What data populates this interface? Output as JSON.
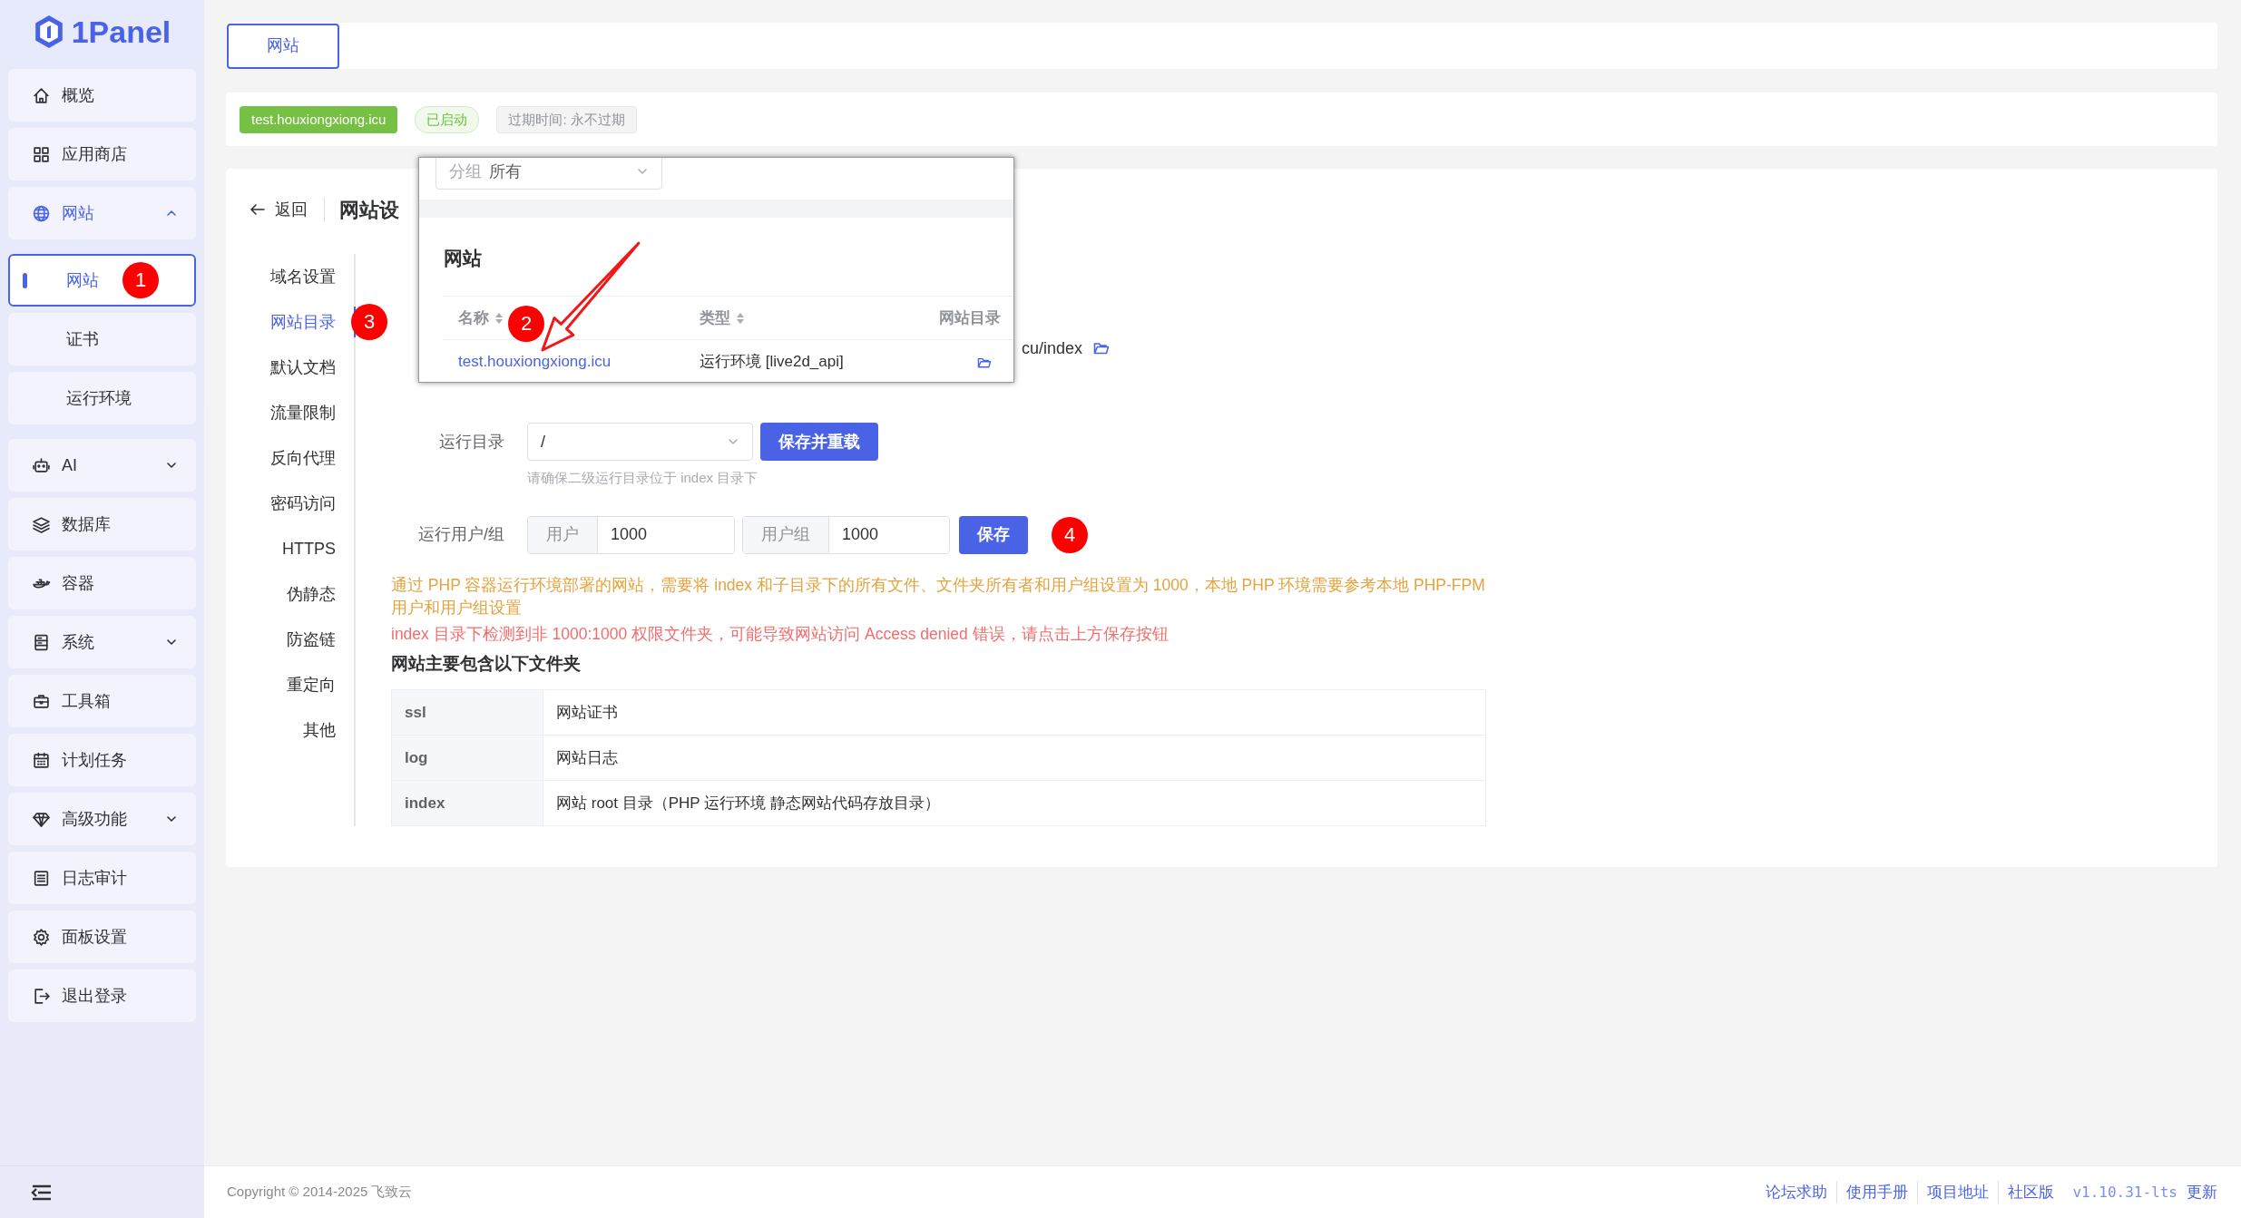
{
  "logo": {
    "text": "1Panel"
  },
  "sidebar": {
    "items": [
      {
        "label": "概览",
        "kind": "link",
        "selected": false
      },
      {
        "label": "应用商店",
        "kind": "link",
        "selected": false
      },
      {
        "label": "网站",
        "kind": "group",
        "selected": true,
        "expanded": true,
        "children": [
          {
            "label": "网站",
            "selected": true,
            "badge": "1"
          },
          {
            "label": "证书",
            "selected": false
          },
          {
            "label": "运行环境",
            "selected": false
          }
        ]
      },
      {
        "label": "AI",
        "kind": "group",
        "selected": false,
        "expanded": false
      },
      {
        "label": "数据库",
        "kind": "link",
        "selected": false
      },
      {
        "label": "容器",
        "kind": "link",
        "selected": false
      },
      {
        "label": "系统",
        "kind": "group",
        "selected": false,
        "expanded": false
      },
      {
        "label": "工具箱",
        "kind": "link",
        "selected": false
      },
      {
        "label": "计划任务",
        "kind": "link",
        "selected": false
      },
      {
        "label": "高级功能",
        "kind": "group",
        "selected": false,
        "expanded": false
      },
      {
        "label": "日志审计",
        "kind": "link",
        "selected": false
      },
      {
        "label": "面板设置",
        "kind": "link",
        "selected": false
      },
      {
        "label": "退出登录",
        "kind": "link",
        "selected": false
      }
    ]
  },
  "tabs": [
    {
      "label": "网站",
      "selected": true
    }
  ],
  "site_bar": {
    "tags": [
      {
        "text": "test.houxiongxiong.icu",
        "kind": "domain"
      },
      {
        "text": "已启动",
        "kind": "status"
      },
      {
        "text": "过期时间: 永不过期",
        "kind": "info"
      }
    ]
  },
  "settings": {
    "back": "返回",
    "title": "网站设",
    "menu": [
      {
        "label": "域名设置",
        "selected": false
      },
      {
        "label": "网站目录",
        "selected": true,
        "badge": "3"
      },
      {
        "label": "默认文档",
        "selected": false
      },
      {
        "label": "流量限制",
        "selected": false
      },
      {
        "label": "反向代理",
        "selected": false
      },
      {
        "label": "密码访问",
        "selected": false
      },
      {
        "label": "HTTPS",
        "selected": false
      },
      {
        "label": "伪静态",
        "selected": false
      },
      {
        "label": "防盗链",
        "selected": false
      },
      {
        "label": "重定向",
        "selected": false
      },
      {
        "label": "其他",
        "selected": false
      }
    ],
    "site_dir": "cu/index",
    "run_dir": {
      "label": "运行目录",
      "value": "/",
      "button": "保存并重载",
      "hint": "请确保二级运行目录位于 index 目录下"
    },
    "run_user": {
      "label": "运行用户/组",
      "user_prefix": "用户",
      "user": "1000",
      "group_prefix": "用户组",
      "group": "1000",
      "button": "保存",
      "badge": "4"
    },
    "warning": "通过 PHP 容器运行环境部署的网站，需要将 index 和子目录下的所有文件、文件夹所有者和用户组设置为 1000，本地 PHP 环境需要参考本地 PHP-FPM 用户和用户组设置",
    "error": "index 目录下检测到非 1000:1000 权限文件夹，可能导致网站访问 Access denied 错误，请点击上方保存按钮",
    "folders_title": "网站主要包含以下文件夹",
    "folders": [
      {
        "name": "ssl",
        "description": "网站证书"
      },
      {
        "name": "log",
        "description": "网站日志"
      },
      {
        "name": "index",
        "description": "网站 root 目录（PHP 运行环境 静态网站代码存放目录）"
      }
    ]
  },
  "popup": {
    "group_prefix": "分组",
    "group_value": "所有",
    "title": "网站",
    "columns": [
      {
        "label": "名称",
        "kind": "sortable"
      },
      {
        "label": "类型",
        "kind": "sortable"
      },
      {
        "label": "网站目录",
        "kind": "plain"
      }
    ],
    "rows": [
      {
        "name": "test.houxiongxiong.icu",
        "type": "运行环境 [live2d_api]",
        "badge": "2"
      }
    ]
  },
  "footer": {
    "copyright": "Copyright © 2014-2025 飞致云",
    "links": [
      {
        "text": "论坛求助",
        "kind": "link"
      },
      {
        "text": "使用手册",
        "kind": "link"
      },
      {
        "text": "项目地址",
        "kind": "link"
      },
      {
        "text": "社区版",
        "kind": "link"
      },
      {
        "text": "v1.10.31-lts",
        "kind": "version"
      },
      {
        "text": "更新",
        "kind": "plain"
      }
    ]
  }
}
